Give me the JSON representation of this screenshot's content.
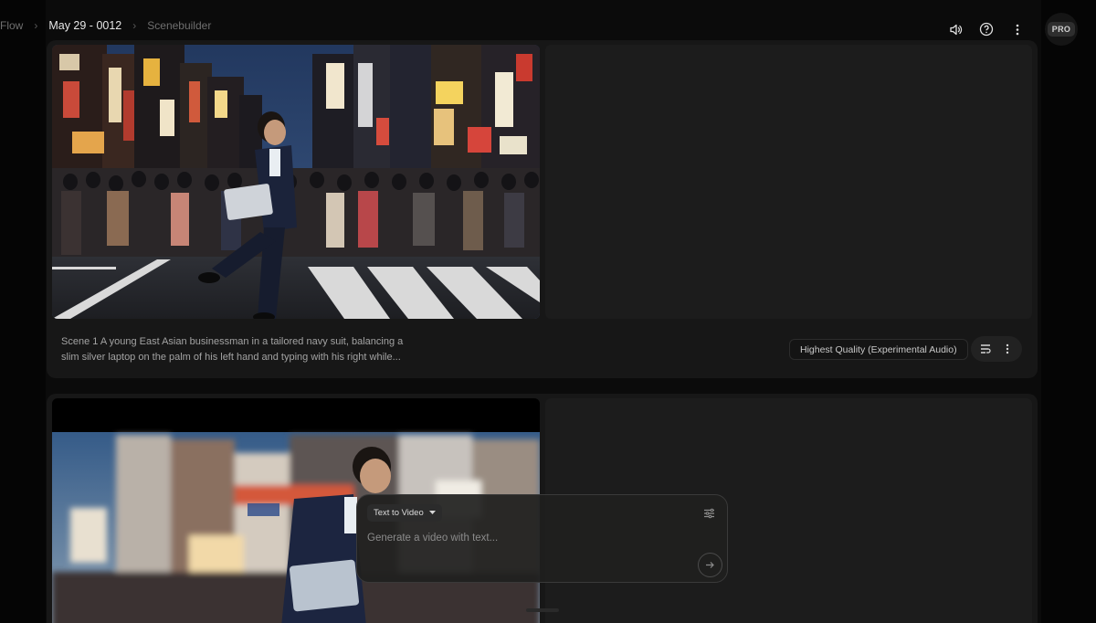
{
  "breadcrumb": {
    "root": "Flow",
    "project": "May 29 - 0012",
    "section": "Scenebuilder"
  },
  "header": {
    "plan_badge": "PRO"
  },
  "scenes": [
    {
      "description": "Scene 1 A young East Asian businessman in a tailored navy suit, balancing a slim silver laptop on the palm of his left hand and typing with his right while...",
      "quality": "Highest Quality (Experimental Audio)"
    },
    {
      "description": "",
      "quality": ""
    }
  ],
  "composer": {
    "mode_label": "Text to Video",
    "placeholder": "Generate a video with text..."
  },
  "colors": {
    "background": "#000000",
    "card": "#171717",
    "panel": "#1c1c1c"
  },
  "icons": [
    "chevron-right-icon",
    "volume-icon",
    "help-icon",
    "more-vert-icon",
    "reorder-icon",
    "caret-down-icon",
    "tune-icon",
    "arrow-right-icon"
  ]
}
